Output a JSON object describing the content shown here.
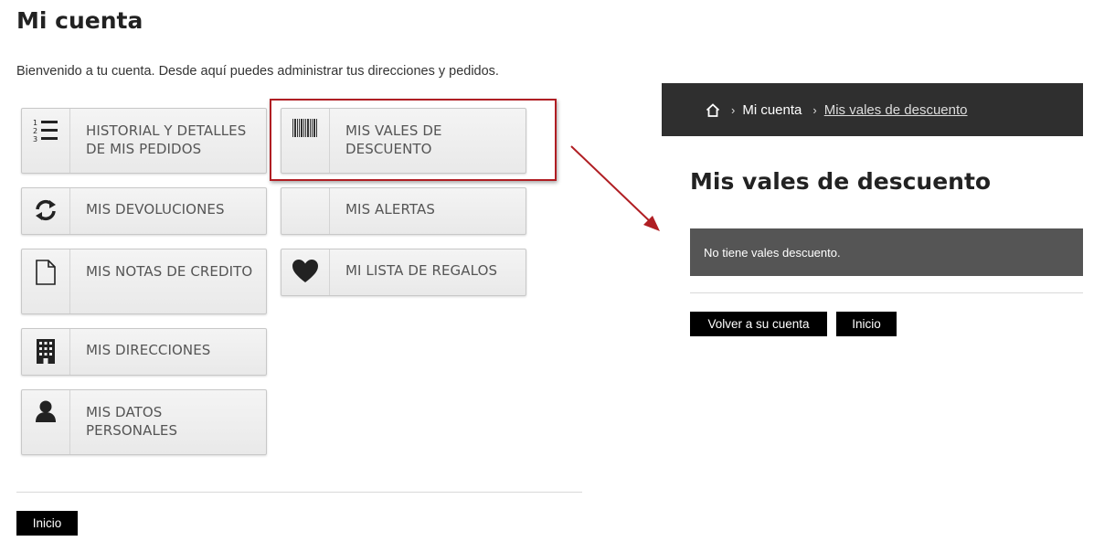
{
  "account": {
    "title": "Mi cuenta",
    "welcome": "Bienvenido a tu cuenta. Desde aquí puedes administrar tus direcciones y pedidos.",
    "buttons": [
      {
        "label": "HISTORIAL Y DETALLES DE MIS PEDIDOS",
        "icon": "ordered-list-icon"
      },
      {
        "label": "MIS VALES DE DESCUENTO",
        "icon": "barcode-icon"
      },
      {
        "label": "MIS DEVOLUCIONES",
        "icon": "refresh-icon"
      },
      {
        "label": "MIS ALERTAS",
        "icon": "none"
      },
      {
        "label": "MIS NOTAS DE CREDITO",
        "icon": "document-icon"
      },
      {
        "label": "MI LISTA DE REGALOS",
        "icon": "heart-icon"
      },
      {
        "label": "MIS DIRECCIONES",
        "icon": "building-icon"
      },
      {
        "label": "MIS DATOS PERSONALES",
        "icon": "user-icon"
      }
    ],
    "home_button": "Inicio"
  },
  "vouchers": {
    "breadcrumb": {
      "home_icon": "home-icon",
      "separator": "›",
      "items": [
        "Mi cuenta",
        "Mis vales de descuento"
      ]
    },
    "title": "Mis vales de descuento",
    "notice": "No tiene vales descuento.",
    "back_button": "Volver a su cuenta",
    "home_button": "Inicio"
  },
  "colors": {
    "highlight_border": "#b01e23",
    "breadcrumb_bg": "#2f2f2f",
    "notice_bg": "#555555",
    "button_bg": "#000000"
  }
}
